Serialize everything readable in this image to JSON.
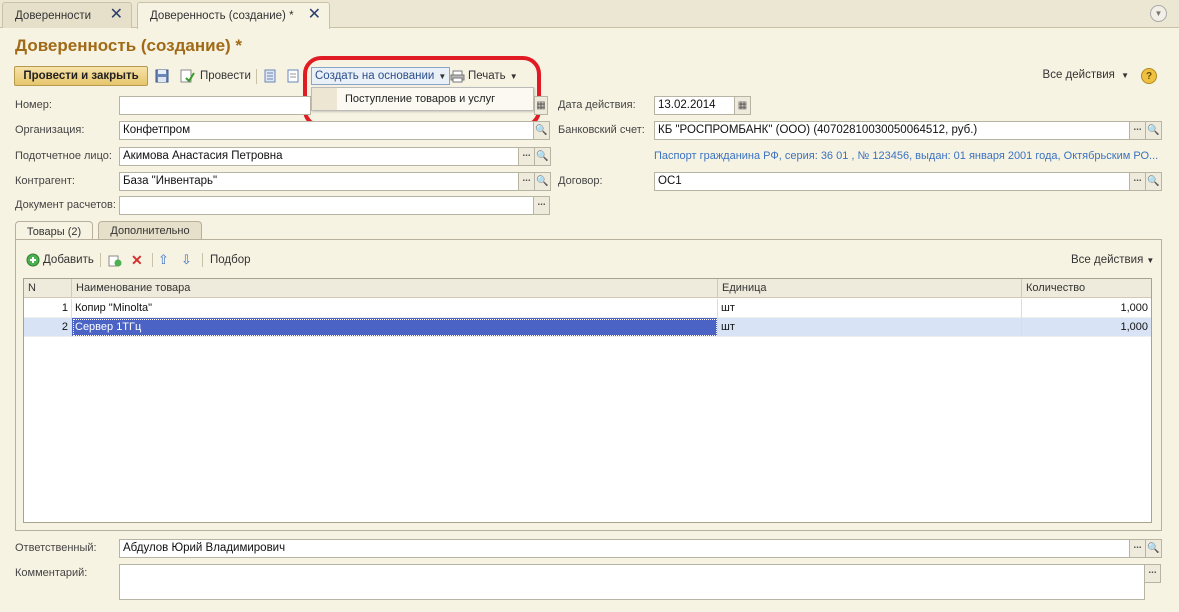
{
  "window_tabs": [
    {
      "label": "Доверенности",
      "close": "✕"
    },
    {
      "label": "Доверенность (создание) *",
      "close": "✕"
    }
  ],
  "title": "Доверенность (создание) *",
  "toolbar": {
    "post_close_label": "Провести и закрыть",
    "post_label": "Провести",
    "create_basis_label": "Создать на основании",
    "print_label": "Печать",
    "all_actions_label": "Все действия",
    "help_label": "?"
  },
  "create_basis_menu": {
    "items": [
      "Поступление товаров и услуг"
    ]
  },
  "form": {
    "number_label": "Номер:",
    "number_value": "",
    "date_label": "Дата действия:",
    "date_value": "13.02.2014",
    "org_label": "Организация:",
    "org_value": "Конфетпром",
    "bank_label": "Банковский счет:",
    "bank_value": "КБ \"РОСПРОМБАНК\" (ООО) (40702810030050064512, руб.)",
    "person_label": "Подотчетное лицо:",
    "person_value": "Акимова Анастасия Петровна",
    "passport_link": "Паспорт гражданина РФ, серия: 36 01 , № 123456, выдан: 01 января 2001 года, Октябрьским РО...",
    "counterparty_label": "Контрагент:",
    "counterparty_value": "База \"Инвентарь\"",
    "contract_label": "Договор:",
    "contract_value": "ОС1",
    "settlement_doc_label": "Документ расчетов:",
    "settlement_doc_value": "",
    "responsible_label": "Ответственный:",
    "responsible_value": "Абдулов Юрий Владимирович",
    "comment_label": "Комментарий:",
    "comment_value": ""
  },
  "inner_tabs": [
    "Товары (2)",
    "Дополнительно"
  ],
  "goods_toolbar": {
    "add_label": "Добавить",
    "selection_label": "Подбор",
    "all_actions_label": "Все действия"
  },
  "table": {
    "columns": [
      "N",
      "Наименование товара",
      "Единица",
      "Количество"
    ],
    "rows": [
      {
        "n": "1",
        "name": "Копир \"Minolta\"",
        "unit": "шт",
        "qty": "1,000"
      },
      {
        "n": "2",
        "name": "Сервер 1ТГц",
        "unit": "шт",
        "qty": "1,000"
      }
    ]
  },
  "colors": {
    "title": "#a06a17",
    "highlight": "#e01b24",
    "link": "#3a72c0",
    "selection": "#4a63c4"
  }
}
